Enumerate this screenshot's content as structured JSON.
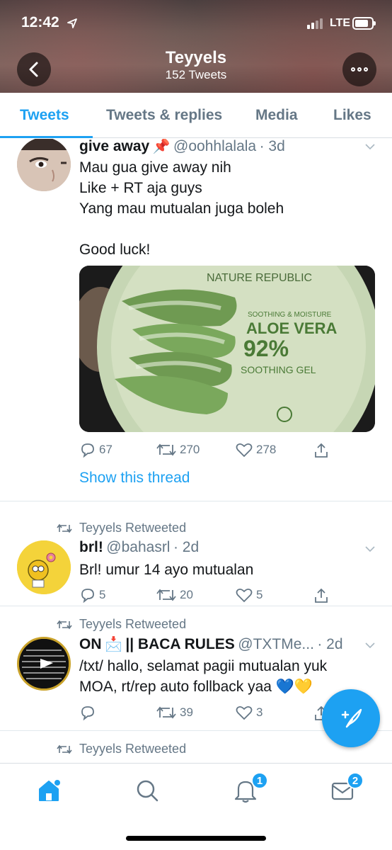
{
  "status_bar": {
    "time": "12:42",
    "network": "LTE"
  },
  "header": {
    "name": "Teyyels",
    "tweet_count": "152 Tweets"
  },
  "tabs": [
    {
      "label": "Tweets",
      "active": true
    },
    {
      "label": "Tweets & replies",
      "active": false
    },
    {
      "label": "Media",
      "active": false
    },
    {
      "label": "Likes",
      "active": false
    }
  ],
  "tweets": [
    {
      "name": "give away",
      "emoji": "📌",
      "handle": "@oohhlalala",
      "time": "· 3d",
      "text": "Mau gua give away nih\nLike + RT aja guys\nYang mau mutualan juga boleh\n\nGood luck!",
      "image": {
        "brand": "NATURE REPUBLIC",
        "line1": "SOOTHING & MOISTURE",
        "line2": "ALOE VERA",
        "line3": "92%",
        "line4": "SOOTHING GEL"
      },
      "replies": "67",
      "retweets": "270",
      "likes": "278",
      "show_thread": "Show this thread"
    },
    {
      "retweeted_by": "Teyyels Retweeted",
      "name": "brl!",
      "handle": "@bahasrl",
      "time": "· 2d",
      "text": "Brl! umur 14 ayo mutualan",
      "replies": "5",
      "retweets": "20",
      "likes": "5"
    },
    {
      "retweeted_by": "Teyyels Retweeted",
      "name": "ON",
      "emoji": "📩",
      "name_rest": "|| BACA RULES",
      "handle": "@TXTMe...",
      "time": "· 2d",
      "text": "/txt/ hallo, selamat pagii mutualan yuk\nMOA, rt/rep auto follback yaa 💙💛",
      "replies": "",
      "retweets": "39",
      "likes": "3"
    },
    {
      "retweeted_by": "Teyyels Retweeted"
    }
  ],
  "tabbar": {
    "notifications_badge": "1",
    "messages_badge": "2"
  },
  "colors": {
    "accent": "#1da1f2",
    "secondary_text": "#657786"
  }
}
